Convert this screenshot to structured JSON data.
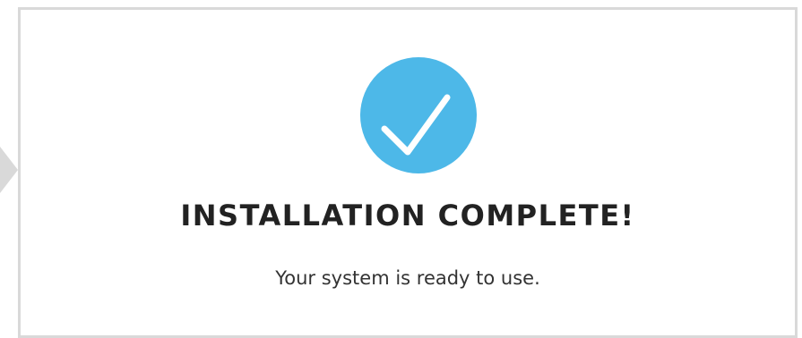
{
  "screen": {
    "title": "INSTALLATION COMPLETE!",
    "message": "Your system is ready to use.",
    "status_icon": "checkmark-icon"
  },
  "colors": {
    "accent": "#4db8e8",
    "border": "#d9d9d9",
    "text_heading": "#222222",
    "text_body": "#333333",
    "background": "#ffffff"
  }
}
